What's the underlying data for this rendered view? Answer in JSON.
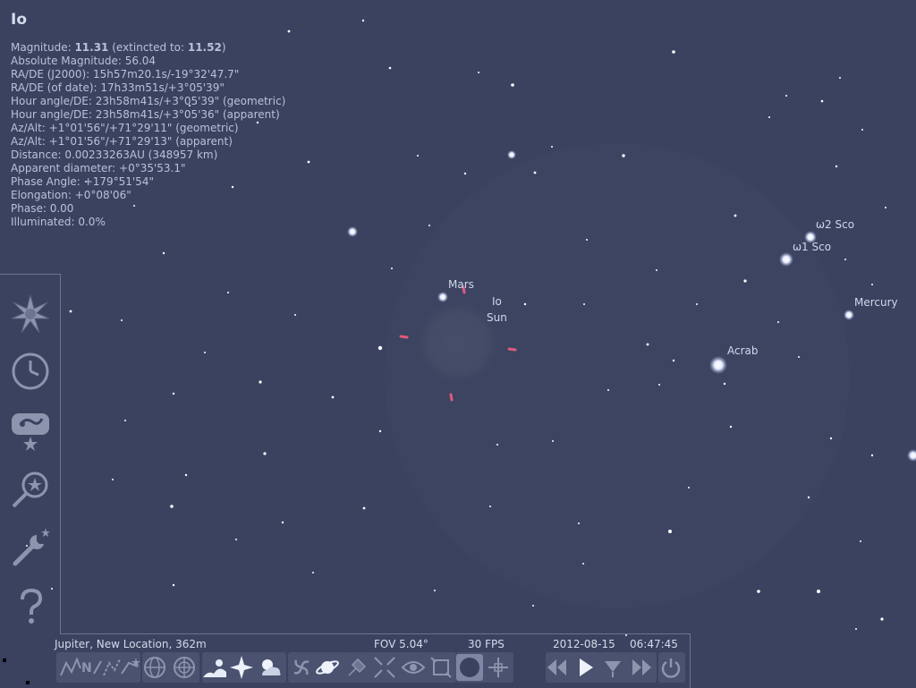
{
  "info": {
    "title": "Io",
    "lines": [
      {
        "label": "Magnitude: ",
        "bold": "11.31",
        "rest": " (extincted to: ",
        "bold2": "11.52",
        "end": ")"
      },
      {
        "text": "Absolute Magnitude: 56.04"
      },
      {
        "text": "RA/DE (J2000): 15h57m20.1s/-19°32'47.7\""
      },
      {
        "text": "RA/DE (of date): 17h33m51s/+3°05'39\""
      },
      {
        "text": "Hour angle/DE: 23h58m41s/+3°05'39\" (geometric)"
      },
      {
        "text": "Hour angle/DE: 23h58m41s/+3°05'36\" (apparent)"
      },
      {
        "text": "Az/Alt: +1°01'56\"/+71°29'11\" (geometric)"
      },
      {
        "text": "Az/Alt: +1°01'56\"/+71°29'13\" (apparent)"
      },
      {
        "text": "Distance: 0.00233263AU (348957 km)"
      },
      {
        "text": "Apparent diameter: +0°35'53.1\""
      },
      {
        "text": "Phase Angle: +179°51'54\""
      },
      {
        "text": "Elongation: +0°08'06\""
      },
      {
        "text": "Phase: 0.00"
      },
      {
        "text": "Illuminated: 0.0%"
      }
    ]
  },
  "sky_labels": {
    "mars": "Mars",
    "io": "Io",
    "sun": "Sun",
    "w2sco": "ω2 Sco",
    "w1sco": "ω1 Sco",
    "mercury": "Mercury",
    "acrab": "Acrab"
  },
  "status": {
    "location": "Jupiter, New Location, 362m",
    "fov": "FOV 5.04°",
    "fps": "30 FPS",
    "date": "2012-08-15",
    "time": "06:47:45"
  },
  "colors": {
    "sky": "#3a4260",
    "pointer": "#e05a7a",
    "panel_border": "#6a7390"
  },
  "left_toolbar_icons": [
    "sky-and-viewing-options-icon",
    "date-time-icon",
    "search-window-icon",
    "find-object-icon",
    "configuration-icon",
    "help-icon"
  ],
  "bottom_toolbar_icons": [
    "constellation-lines-icon",
    "constellation-labels-icon",
    "constellation-art-icon",
    "constellation-boundaries-icon",
    "equatorial-grid-icon",
    "azimuthal-grid-icon",
    "ground-icon",
    "cardinal-points-icon",
    "atmosphere-icon",
    "nebulas-icon",
    "planet-hints-icon",
    "satellites-icon",
    "mount-mode-icon",
    "goto-selected-icon",
    "night-mode-icon",
    "fullscreen-icon",
    "ocular-icon",
    "sensor-frame-icon",
    "telescope-icon",
    "decrease-time-speed-icon",
    "play-icon",
    "set-time-now-icon",
    "increase-time-speed-icon",
    "quit-icon"
  ]
}
